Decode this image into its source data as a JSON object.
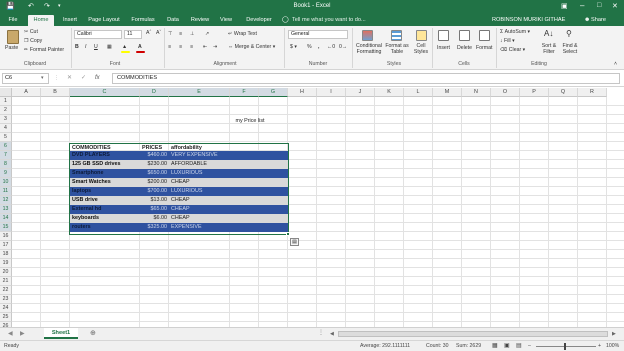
{
  "window": {
    "title": "Book1 - Excel",
    "user": "ROBINSON MURIKI GITHAE",
    "share": "Share"
  },
  "tabs": [
    "File",
    "Home",
    "Insert",
    "Page Layout",
    "Formulas",
    "Data",
    "Review",
    "View",
    "Developer"
  ],
  "tell_me": "Tell me what you want to do...",
  "ribbon": {
    "paste": "Paste",
    "cut": "Cut",
    "copy": "Copy",
    "format_painter": "Format Painter",
    "font_name": "Calibri",
    "font_size": "11",
    "wrap_text": "Wrap Text",
    "merge_center": "Merge & Center",
    "number_format": "General",
    "percent": "%",
    "comma": ",",
    "conditional_formatting": "Conditional Formatting",
    "format_as_table": "Format as Table",
    "cell_styles": "Cell Styles",
    "insert": "Insert",
    "delete": "Delete",
    "format": "Format",
    "autosum": "AutoSum",
    "fill": "Fill",
    "clear": "Clear",
    "sort_filter": "Sort & Filter",
    "find_select": "Find & Select",
    "groups": {
      "clipboard": "Clipboard",
      "font": "Font",
      "alignment": "Alignment",
      "number": "Number",
      "styles": "Styles",
      "cells": "Cells",
      "editing": "Editing"
    }
  },
  "formula_bar": {
    "name_box": "C6",
    "fx": "fx",
    "content": "COMMODITIES"
  },
  "columns": [
    "A",
    "B",
    "C",
    "D",
    "E",
    "F",
    "G",
    "H",
    "I",
    "J",
    "K",
    "L",
    "M",
    "N",
    "O",
    "P",
    "Q",
    "R"
  ],
  "rows": [
    "1",
    "2",
    "3",
    "4",
    "5",
    "6",
    "7",
    "8",
    "9",
    "10",
    "11",
    "12",
    "13",
    "14",
    "15",
    "16",
    "17",
    "18",
    "19",
    "20",
    "21",
    "22",
    "23",
    "24",
    "25",
    "26"
  ],
  "sheet": {
    "title_cell": "my Price list",
    "headers": [
      "COMMODITIES",
      "PRICES",
      "affordability"
    ],
    "data": [
      {
        "item": "DVD PLAYERS",
        "price": "$460.00",
        "afford": "VERY EXPENSIVE",
        "style": "blue"
      },
      {
        "item": "125 GB SSD drives",
        "price": "$230.00",
        "afford": "AFFORDABLE",
        "style": "grey"
      },
      {
        "item": "Smartphone",
        "price": "$650.00",
        "afford": "LUXURIOUS",
        "style": "blue"
      },
      {
        "item": "Smart Watches",
        "price": "$200.00",
        "afford": "CHEAP",
        "style": "grey"
      },
      {
        "item": "laptops",
        "price": "$700.00",
        "afford": "LUXURIOUS",
        "style": "blue"
      },
      {
        "item": "USB drive",
        "price": "$13.00",
        "afford": "CHEAP",
        "style": "grey"
      },
      {
        "item": "External hd",
        "price": "$65.00",
        "afford": "CHEAP",
        "style": "blue"
      },
      {
        "item": "keyboards",
        "price": "$6.00",
        "afford": "CHEAP",
        "style": "grey"
      },
      {
        "item": "routers",
        "price": "$325.00",
        "afford": "EXPENSIVE",
        "style": "blue"
      }
    ]
  },
  "sheet_tabs": [
    "Sheet1"
  ],
  "status": {
    "ready": "Ready",
    "average": "Average: 292.1111111",
    "count": "Count: 30",
    "sum": "Sum: 2629",
    "zoom": "100%"
  },
  "colors": {
    "excel_green": "#217346",
    "band_blue": "#2f52a0",
    "band_grey": "#d9d9d9"
  }
}
